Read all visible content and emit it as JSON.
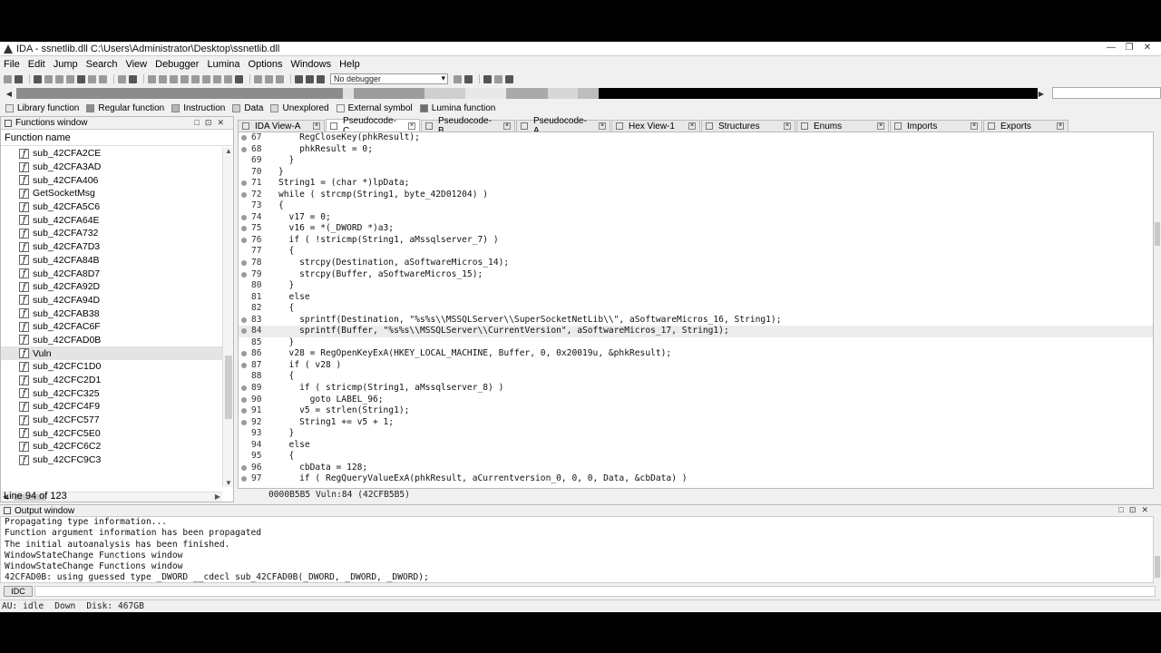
{
  "window": {
    "title": "IDA - ssnetlib.dll C:\\Users\\Administrator\\Desktop\\ssnetlib.dll",
    "controls": [
      "—",
      "❐",
      "✕"
    ]
  },
  "menu": [
    "File",
    "Edit",
    "Jump",
    "Search",
    "View",
    "Debugger",
    "Lumina",
    "Options",
    "Windows",
    "Help"
  ],
  "toolbar": {
    "debugger_select": "No debugger"
  },
  "navband": {
    "segments": [
      {
        "start": 0.0,
        "end": 0.32,
        "color": "#8c8c8c"
      },
      {
        "start": 0.32,
        "end": 0.33,
        "color": "#e0e0e0"
      },
      {
        "start": 0.33,
        "end": 0.4,
        "color": "#9c9c9c"
      },
      {
        "start": 0.4,
        "end": 0.44,
        "color": "#cfcfcf"
      },
      {
        "start": 0.44,
        "end": 0.48,
        "color": "#e8e8e8"
      },
      {
        "start": 0.48,
        "end": 0.52,
        "color": "#aaaaaa"
      },
      {
        "start": 0.52,
        "end": 0.55,
        "color": "#d7d7d7"
      },
      {
        "start": 0.55,
        "end": 0.57,
        "color": "#bdbdbd"
      },
      {
        "start": 0.57,
        "end": 1.0,
        "color": "#000000"
      }
    ]
  },
  "legend": [
    {
      "label": "Library function",
      "color": "#e8e8e8"
    },
    {
      "label": "Regular function",
      "color": "#8c8c8c"
    },
    {
      "label": "Instruction",
      "color": "#b5b5b5"
    },
    {
      "label": "Data",
      "color": "#cfcfcf"
    },
    {
      "label": "Unexplored",
      "color": "#d9d9d9"
    },
    {
      "label": "External symbol",
      "color": "#f0f0f0"
    },
    {
      "label": "Lumina function",
      "color": "#6e6e6e"
    }
  ],
  "functions_window": {
    "title": "Functions window",
    "column": "Function name",
    "icon_letter": "f",
    "items": [
      "sub_42CFA2CE",
      "sub_42CFA3AD",
      "sub_42CFA406",
      "GetSocketMsg",
      "sub_42CFA5C6",
      "sub_42CFA64E",
      "sub_42CFA732",
      "sub_42CFA7D3",
      "sub_42CFA84B",
      "sub_42CFA8D7",
      "sub_42CFA92D",
      "sub_42CFA94D",
      "sub_42CFAB38",
      "sub_42CFAC6F",
      "sub_42CFAD0B",
      "Vuln",
      "sub_42CFC1D0",
      "sub_42CFC2D1",
      "sub_42CFC325",
      "sub_42CFC4F9",
      "sub_42CFC577",
      "sub_42CFC5E0",
      "sub_42CFC6C2",
      "sub_42CFC9C3"
    ],
    "selected_index": 15,
    "line_status": "Line 94 of 123"
  },
  "tabs": [
    {
      "label": "IDA View-A",
      "active": false
    },
    {
      "label": "Pseudocode-C",
      "active": true
    },
    {
      "label": "Pseudocode-B",
      "active": false
    },
    {
      "label": "Pseudocode-A",
      "active": false
    },
    {
      "label": "Hex View-1",
      "active": false
    },
    {
      "label": "Structures",
      "active": false
    },
    {
      "label": "Enums",
      "active": false
    },
    {
      "label": "Imports",
      "active": false
    },
    {
      "label": "Exports",
      "active": false
    }
  ],
  "code": {
    "current_line": 84,
    "lines": [
      {
        "n": "67",
        "dot": true,
        "text": "    RegCloseKey(phkResult);"
      },
      {
        "n": "68",
        "dot": true,
        "text": "    phkResult = 0;"
      },
      {
        "n": "69",
        "dot": false,
        "text": "  }"
      },
      {
        "n": "70",
        "dot": false,
        "text": "}"
      },
      {
        "n": "71",
        "dot": true,
        "text": "String1 = (char *)lpData;"
      },
      {
        "n": "72",
        "dot": true,
        "text": "while ( strcmp(String1, byte_42D01204) )"
      },
      {
        "n": "73",
        "dot": false,
        "text": "{"
      },
      {
        "n": "74",
        "dot": true,
        "text": "  v17 = 0;"
      },
      {
        "n": "75",
        "dot": true,
        "text": "  v16 = *(_DWORD *)a3;"
      },
      {
        "n": "76",
        "dot": true,
        "text": "  if ( !stricmp(String1, aMssqlserver_7) )"
      },
      {
        "n": "77",
        "dot": false,
        "text": "  {"
      },
      {
        "n": "78",
        "dot": true,
        "text": "    strcpy(Destination, aSoftwareMicros_14);"
      },
      {
        "n": "79",
        "dot": true,
        "text": "    strcpy(Buffer, aSoftwareMicros_15);"
      },
      {
        "n": "80",
        "dot": false,
        "text": "  }"
      },
      {
        "n": "81",
        "dot": false,
        "text": "  else"
      },
      {
        "n": "82",
        "dot": false,
        "text": "  {"
      },
      {
        "n": "83",
        "dot": true,
        "text": "    sprintf(Destination, \"%s%s\\\\MSSQLServer\\\\SuperSocketNetLib\\\\\", aSoftwareMicros_16, String1);"
      },
      {
        "n": "84",
        "dot": true,
        "text": "    sprintf(Buffer, \"%s%s\\\\MSSQLServer\\\\CurrentVersion\", aSoftwareMicros_17, String1);"
      },
      {
        "n": "85",
        "dot": false,
        "text": "  }"
      },
      {
        "n": "86",
        "dot": true,
        "text": "  v28 = RegOpenKeyExA(HKEY_LOCAL_MACHINE, Buffer, 0, 0x20019u, &phkResult);"
      },
      {
        "n": "87",
        "dot": true,
        "text": "  if ( v28 )"
      },
      {
        "n": "88",
        "dot": false,
        "text": "  {"
      },
      {
        "n": "89",
        "dot": true,
        "text": "    if ( stricmp(String1, aMssqlserver_8) )"
      },
      {
        "n": "90",
        "dot": true,
        "text": "      goto LABEL_96;"
      },
      {
        "n": "91",
        "dot": true,
        "text": "    v5 = strlen(String1);"
      },
      {
        "n": "92",
        "dot": true,
        "text": "    String1 += v5 + 1;"
      },
      {
        "n": "93",
        "dot": false,
        "text": "  }"
      },
      {
        "n": "94",
        "dot": false,
        "text": "  else"
      },
      {
        "n": "95",
        "dot": false,
        "text": "  {"
      },
      {
        "n": "96",
        "dot": true,
        "text": "    cbData = 128;"
      },
      {
        "n": "97",
        "dot": true,
        "text": "    if ( RegQueryValueExA(phkResult, aCurrentversion_0, 0, 0, Data, &cbData) )"
      }
    ],
    "status": "0000B5B5 Vuln:84 (42CFB5B5)"
  },
  "output": {
    "title": "Output window",
    "lines": [
      "Propagating type information...",
      "Function argument information has been propagated",
      "The initial autoanalysis has been finished.",
      "WindowStateChange Functions window",
      "WindowStateChange Functions window",
      "42CFAD0B: using guessed type _DWORD __cdecl sub_42CFAD0B(_DWORD, _DWORD, _DWORD);"
    ]
  },
  "cmdline": {
    "button": "IDC"
  },
  "statusbar": {
    "au": "AU:  idle",
    "dir": "Down",
    "disk": "Disk: 467GB"
  }
}
